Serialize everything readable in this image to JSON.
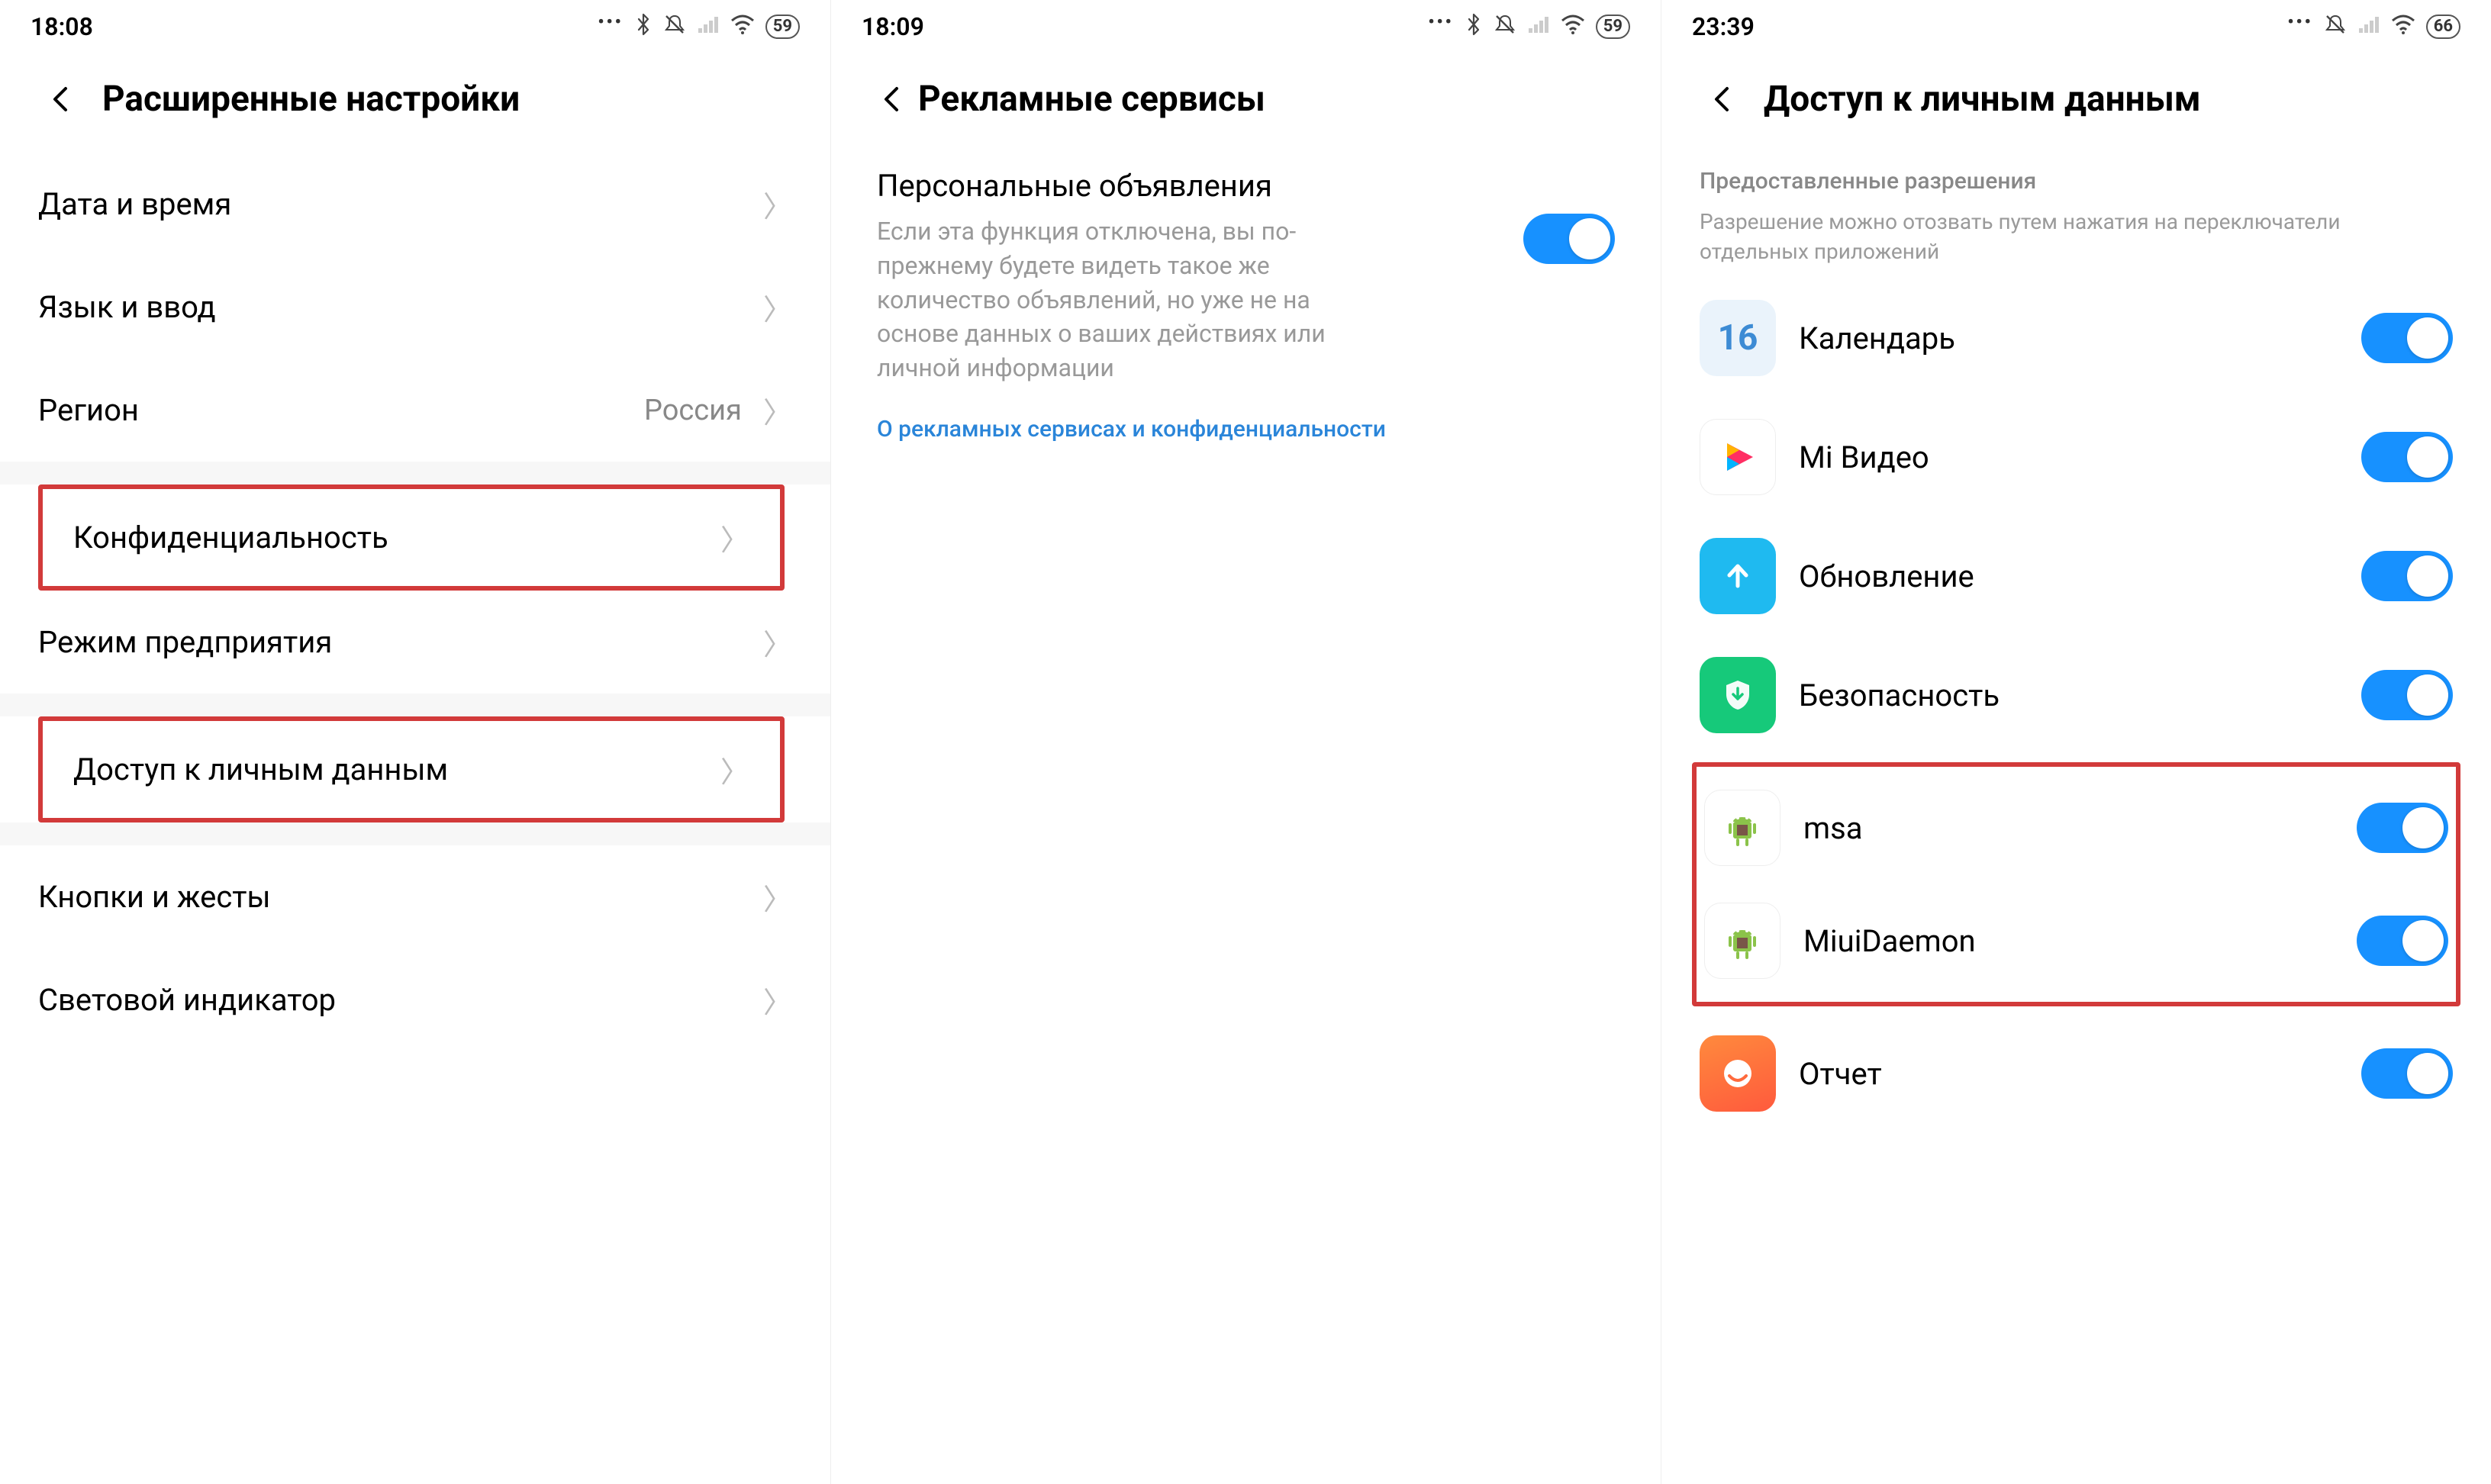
{
  "screen1": {
    "status": {
      "time": "18:08",
      "battery": "59"
    },
    "title": "Расширенные настройки",
    "rows": {
      "datetime": "Дата и время",
      "lang": "Язык и ввод",
      "region_label": "Регион",
      "region_value": "Россия",
      "privacy": "Конфиденциальность",
      "enterprise": "Режим предприятия",
      "personal_data": "Доступ к личным данным",
      "buttons": "Кнопки и жесты",
      "led": "Световой индикатор"
    }
  },
  "screen2": {
    "status": {
      "time": "18:09",
      "battery": "59"
    },
    "title": "Рекламные сервисы",
    "ad_title": "Персональные объявления",
    "ad_desc": "Если эта функция отключена, вы по-прежнему будете видеть такое же количество объявлений, но уже не на основе данных о ваших действиях или личной информации",
    "link": "О рекламных сервисах и конфиденциальности"
  },
  "screen3": {
    "status": {
      "time": "23:39",
      "battery": "66"
    },
    "title": "Доступ к личным данным",
    "sub_title": "Предоставленные разрешения",
    "sub_desc": "Разрешение можно отозвать путем нажатия на переключатели отдельных приложений",
    "apps": {
      "calendar": {
        "label": "Календарь",
        "icon_text": "16"
      },
      "mivideo": {
        "label": "Mi Видео"
      },
      "update": {
        "label": "Обновление"
      },
      "security": {
        "label": "Безопасность"
      },
      "msa": {
        "label": "msa"
      },
      "miuidaemon": {
        "label": "MiuiDaemon"
      },
      "report": {
        "label": "Отчет"
      }
    }
  }
}
